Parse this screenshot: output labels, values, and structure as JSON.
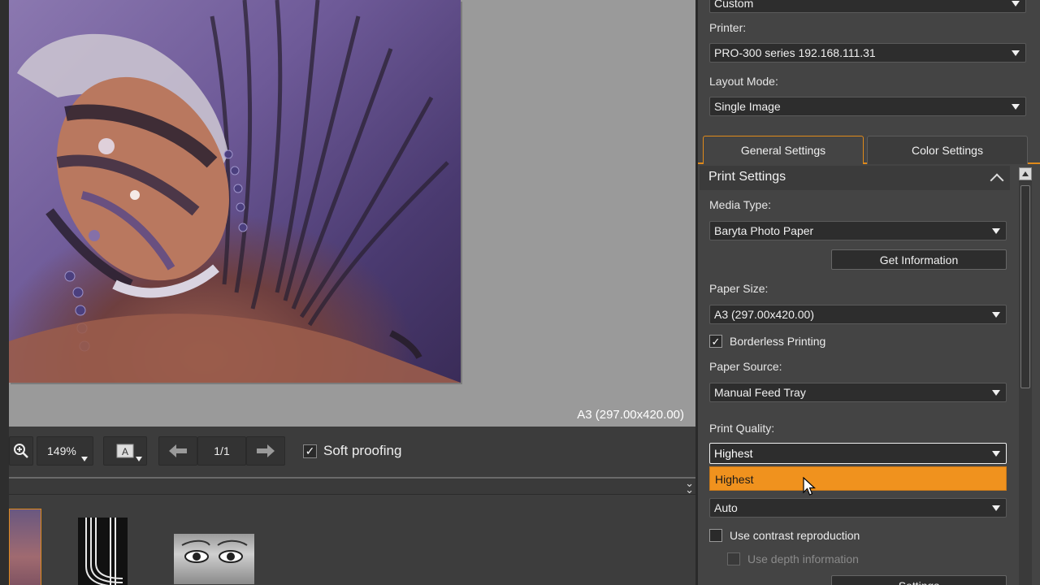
{
  "preview": {
    "paper_size_label": "A3 (297.00x420.00)"
  },
  "toolbar": {
    "zoom_value": "149%",
    "page_indicator": "1/1",
    "soft_proofing_label": "Soft proofing",
    "soft_proofing_checked": true,
    "view_button_glyph": "A"
  },
  "settings": {
    "top_select_value": "Custom",
    "printer_label": "Printer:",
    "printer_value": "PRO-300 series 192.168.111.31",
    "layout_mode_label": "Layout Mode:",
    "layout_mode_value": "Single Image",
    "tabs": [
      {
        "label": "General Settings",
        "active": true
      },
      {
        "label": "Color Settings",
        "active": false
      }
    ],
    "section_title": "Print Settings",
    "media_type_label": "Media Type:",
    "media_type_value": "Baryta Photo Paper",
    "get_information_label": "Get Information",
    "paper_size_label": "Paper Size:",
    "paper_size_value": "A3 (297.00x420.00)",
    "borderless_label": "Borderless Printing",
    "borderless_checked": true,
    "paper_source_label": "Paper Source:",
    "paper_source_value": "Manual Feed Tray",
    "print_quality_label": "Print Quality:",
    "print_quality_value": "Highest",
    "print_quality_options": [
      "Highest"
    ],
    "next_select_value": "Auto",
    "contrast_label": "Use contrast reproduction",
    "contrast_checked": false,
    "depth_label": "Use depth information",
    "depth_checked": false,
    "settings_button_label": "Settings"
  },
  "colors": {
    "accent": "#f0921e",
    "panel_bg": "#444444",
    "preview_bg": "#9a9a9a"
  },
  "icons": [
    "zoom-in-icon",
    "view-mode-icon",
    "arrow-left-icon",
    "arrow-right-icon",
    "collapse-icon",
    "chevron-up-icon",
    "dropdown-arrow-icon",
    "mouse-cursor-icon"
  ]
}
